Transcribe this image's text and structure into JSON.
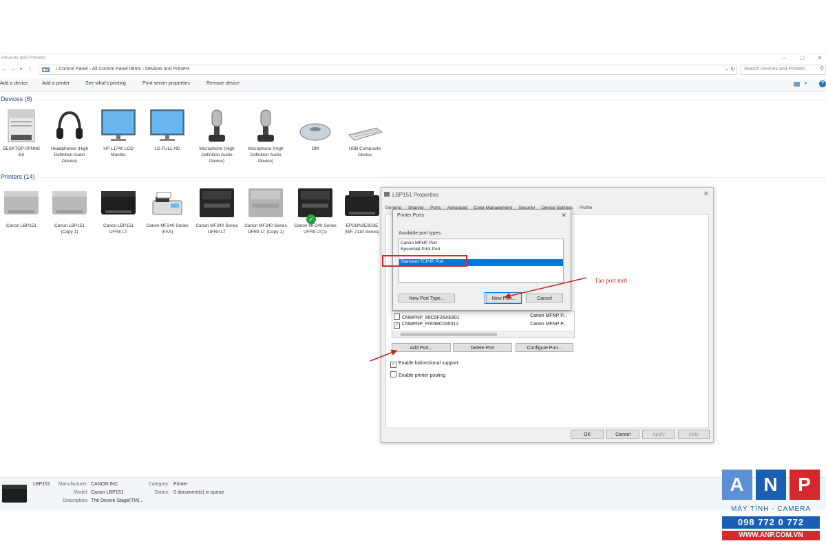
{
  "window": {
    "title": "Devices and Printers",
    "min_glyph": "–",
    "max_glyph": "□",
    "close_glyph": "✕"
  },
  "address": {
    "breadcrumb": [
      "Control Panel",
      "All Control Panel Items",
      "Devices and Printers"
    ],
    "separator": "›",
    "search_placeholder": "Search Devices and Printers"
  },
  "toolbar": {
    "commands": [
      "Add a device",
      "Add a printer",
      "See what's printing",
      "Print server properties",
      "Remove device"
    ]
  },
  "devices": {
    "heading": "Devices (8)",
    "items": [
      {
        "label": "DESKTOP-0PNNK E8",
        "icon": "computer-icon"
      },
      {
        "label": "Headphones (High Definition Audio Device)",
        "icon": "headphones-icon"
      },
      {
        "label": "HP L1740 LCD Monitor",
        "icon": "monitor-icon"
      },
      {
        "label": "LG FULL HD",
        "icon": "monitor-icon"
      },
      {
        "label": "Microphone (High Definition Audio Device)",
        "icon": "microphone-icon"
      },
      {
        "label": "Microphone (High Definition Audio Device)",
        "icon": "microphone-icon"
      },
      {
        "label": "OM",
        "icon": "mouse-icon"
      },
      {
        "label": "USB Composite Device",
        "icon": "keyboard-icon"
      }
    ]
  },
  "printers": {
    "heading": "Printers (14)",
    "items": [
      {
        "label": "Canon LBP151"
      },
      {
        "label": "Canon LBP151 (Copy 1)"
      },
      {
        "label": "Canon LBP151 UFRII LT"
      },
      {
        "label": "Canon MF240 Series (FAX)"
      },
      {
        "label": "Canon MF240 Series UFRII LT"
      },
      {
        "label": "Canon MF240 Series UFRII LT (Copy 1)"
      },
      {
        "label": "Canon MF240 Series UFRII LT(1)",
        "default": true
      },
      {
        "label": "EPSON2E9D3E (WF-7110 Series)"
      }
    ]
  },
  "properties_dialog": {
    "title": "LBP151 Properties",
    "tabs": [
      "General",
      "Sharing",
      "Ports",
      "Advanced",
      "Color Management",
      "Security",
      "Device Settings",
      "Profile"
    ],
    "port_rows": [
      {
        "checked": false,
        "port": "CNMFNP_80C5F26AE801",
        "desc": "Canon MFNP P..."
      },
      {
        "checked": true,
        "port": "CNMFNP_F0038C035312",
        "desc": "Canon MFNP P..."
      }
    ],
    "add_port": "Add Port...",
    "delete_port": "Delete Port",
    "configure_port": "Configure Port...",
    "bidirectional": "Enable bidirectional support",
    "pooling": "Enable printer pooling",
    "ok": "OK",
    "cancel": "Cancel",
    "apply": "Apply",
    "help": "Help"
  },
  "ports_dialog": {
    "title": "Printer Ports",
    "label": "Available port types:",
    "port_types": [
      "Canon MFNP Port",
      "EpsonNet Print Port",
      "Standard TCP/IP Port"
    ],
    "selected_index": 2,
    "new_port_type": "New Port Type...",
    "new_port": "New Port...",
    "cancel": "Cancel"
  },
  "annotation": {
    "text": "Tạo port mới",
    "color": "#c0261e"
  },
  "status": {
    "name": "LBP151",
    "manufacturer_label": "Manufacturer:",
    "manufacturer": "CANON INC.",
    "model_label": "Model:",
    "model": "Canon LBP151",
    "description_label": "Description:",
    "description": "The Device Stage(TM)...",
    "category_label": "Category:",
    "category": "Printer",
    "status_label": "Status:",
    "status": "0 document(s) in queue"
  },
  "logo": {
    "letters": [
      "A",
      "N",
      "P"
    ],
    "tagline": "MÁY TÍNH - CAMERA",
    "phone": "098 772 0 772",
    "website": "WWW.ANP.COM.VN",
    "colors": {
      "blue": "#1a5fb4",
      "red": "#d6282d",
      "light_blue": "#5b8fd6"
    }
  }
}
